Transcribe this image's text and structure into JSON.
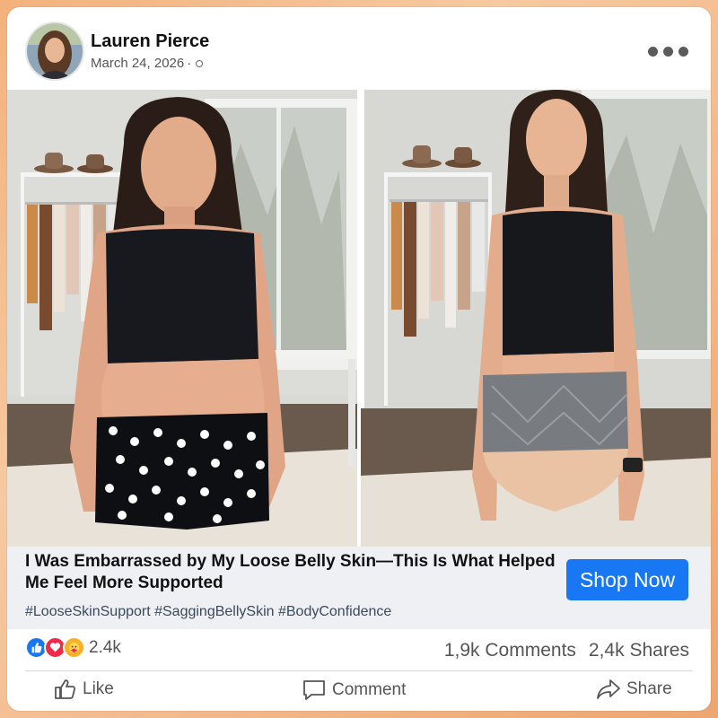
{
  "post": {
    "author": "Lauren Pierce",
    "date": "March 24, 2026",
    "separator": "·",
    "headline": "I Was Embarrassed by My Loose Belly Skin—This Is What Helped Me Feel More Supported",
    "hashtags": "#LooseSkinSupport #SaggingBellySkin #BodyConfidence",
    "cta_label": "Shop Now"
  },
  "stats": {
    "reaction_count": "2.4k",
    "comments": "1,9k Comments",
    "shares": "2,4k Shares"
  },
  "actions": {
    "like": "Like",
    "comment": "Comment",
    "share": "Share"
  },
  "icons": {
    "reactions": [
      "like-icon",
      "love-icon",
      "care-icon"
    ],
    "more": "more-options-icon",
    "privacy": "globe-icon"
  },
  "colors": {
    "accent": "#1877f2",
    "love": "#f0284a",
    "care": "#f7b125",
    "background_gradient": "#f3b27c"
  }
}
